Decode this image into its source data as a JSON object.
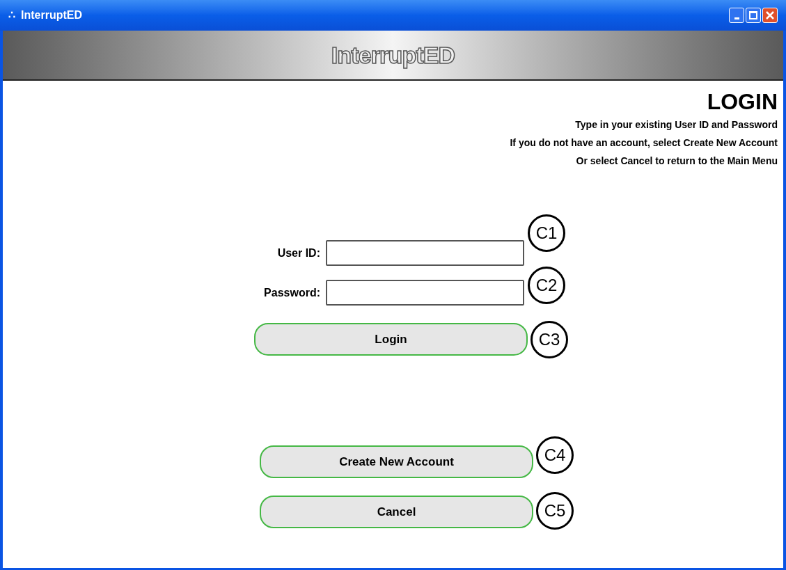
{
  "window": {
    "title_icon": "∴",
    "title": "InterruptED"
  },
  "banner": {
    "logo": "InterruptED"
  },
  "heading": "LOGIN",
  "instructions": [
    "Type in your existing User ID and Password",
    "If you do not have an account, select Create New Account",
    "Or select Cancel to return to the Main Menu"
  ],
  "fields": [
    {
      "label": "User ID:",
      "callout": "C1"
    },
    {
      "label": "Password:",
      "callout": "C2"
    }
  ],
  "buttons": [
    {
      "label": "Login",
      "callout": "C3"
    },
    {
      "label": "Create New Account",
      "callout": "C4"
    },
    {
      "label": "Cancel",
      "callout": "C5"
    }
  ]
}
